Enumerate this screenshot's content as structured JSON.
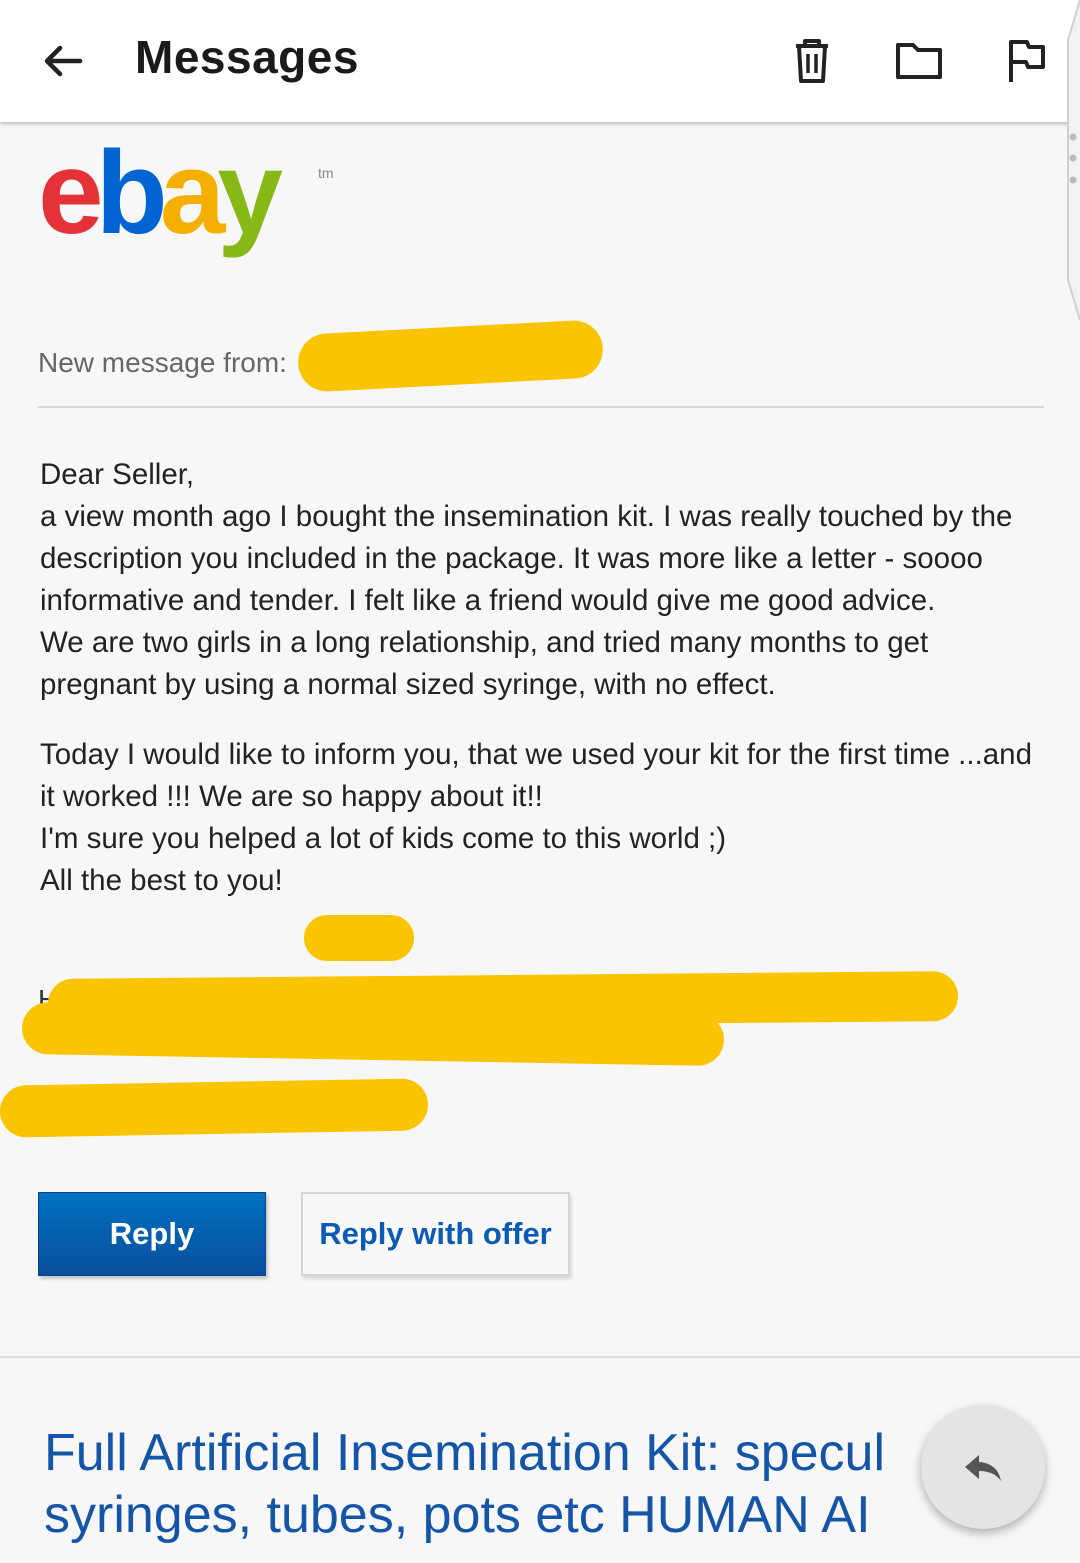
{
  "header": {
    "title": "Messages",
    "icons": [
      "back-arrow-icon",
      "trash-icon",
      "folder-icon",
      "flag-icon"
    ]
  },
  "brand": {
    "logo_text": "ebay",
    "trademark": "tm",
    "colors": {
      "e": "#e53238",
      "b": "#0064d2",
      "a": "#f5af02",
      "y": "#86b817"
    }
  },
  "message": {
    "from_label": "New message from:",
    "paragraph1": [
      "Dear Seller,",
      "a view month ago I bought the insemination kit. I was really touched by the description you included in the package. It was more like a letter - soooo informative and tender. I felt like a friend would give me good advice.",
      "We are two girls in a long relationship, and tried many months to get pregnant by using a normal sized syringe, with no effect."
    ],
    "paragraph2": [
      "Today I would like to inform you, that we used your kit for the first time ...and it worked !!! We are so happy about it!!",
      "I'm sure you helped a lot of kids come to this world ;)",
      "All the best to you!"
    ],
    "redaction_color": "#fbc400"
  },
  "actions": {
    "reply_label": "Reply",
    "reply_offer_label": "Reply with offer"
  },
  "item": {
    "title": "Full Artificial Insemination Kit: speculum, syringes, tubes, pots etc HUMAN AI",
    "title_line1": "Full Artificial Insemination Kit: specul",
    "title_line2": "syringes, tubes, pots etc HUMAN AI"
  },
  "fab": {
    "icon": "reply-arrow-icon"
  }
}
